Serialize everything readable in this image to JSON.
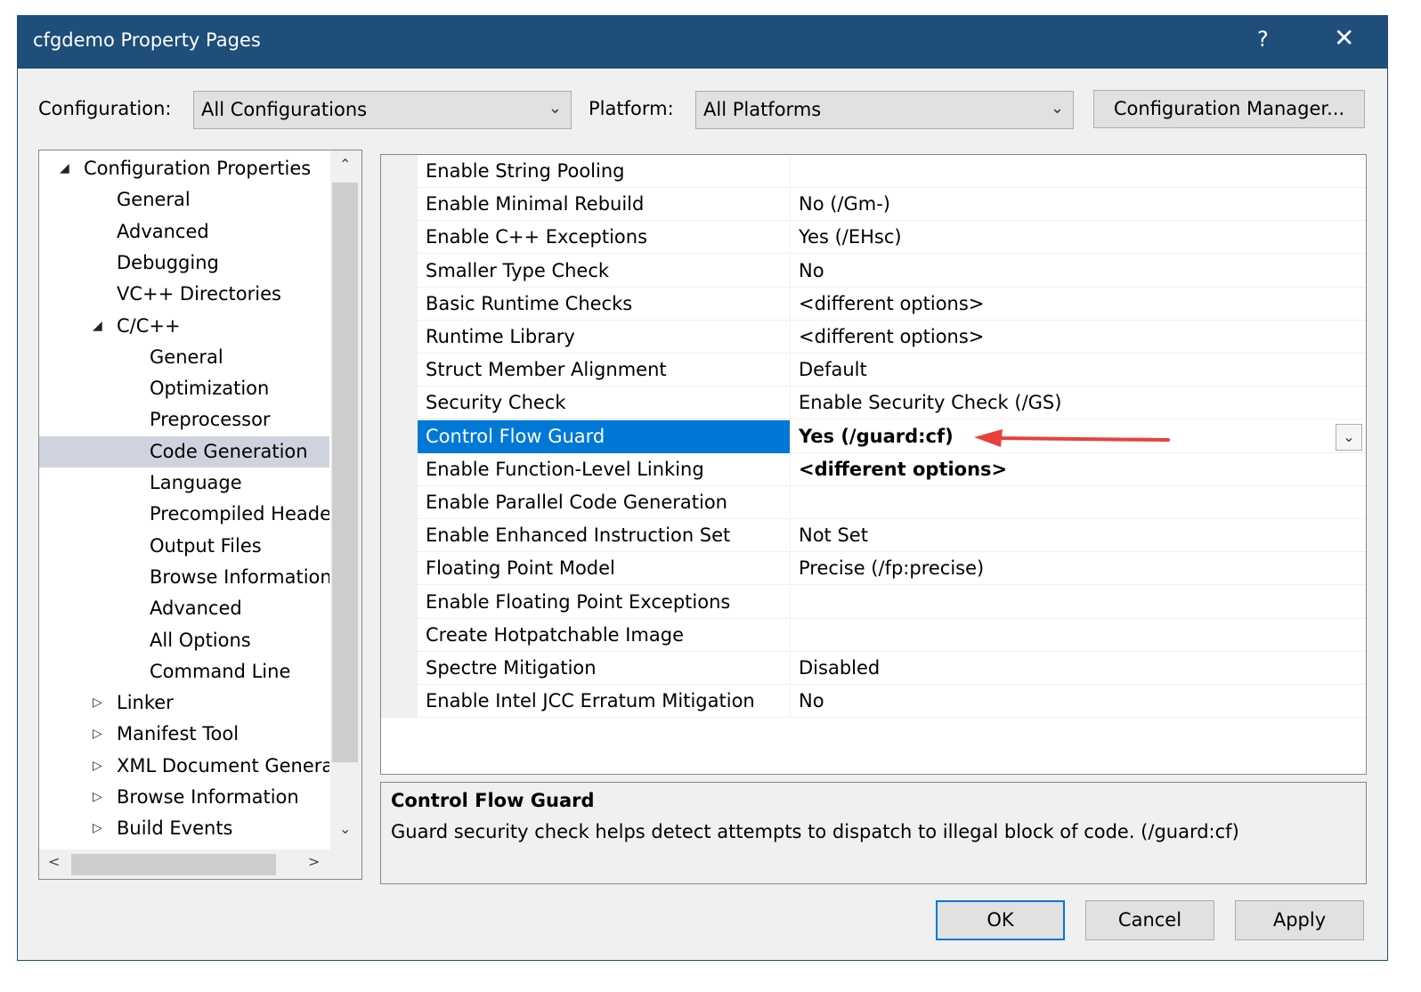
{
  "window": {
    "title": "cfgdemo Property Pages",
    "help": "?",
    "close": "✕"
  },
  "toolbar": {
    "configuration_label": "Configuration:",
    "configuration_value": "All Configurations",
    "platform_label": "Platform:",
    "platform_value": "All Platforms",
    "config_manager": "Configuration Manager..."
  },
  "tree": [
    {
      "label": "Configuration Properties",
      "level": 0,
      "expander": "expanded"
    },
    {
      "label": "General",
      "level": 1,
      "expander": "none"
    },
    {
      "label": "Advanced",
      "level": 1,
      "expander": "none"
    },
    {
      "label": "Debugging",
      "level": 1,
      "expander": "none"
    },
    {
      "label": "VC++ Directories",
      "level": 1,
      "expander": "none"
    },
    {
      "label": "C/C++",
      "level": 1,
      "expander": "expanded"
    },
    {
      "label": "General",
      "level": 2,
      "expander": "none"
    },
    {
      "label": "Optimization",
      "level": 2,
      "expander": "none"
    },
    {
      "label": "Preprocessor",
      "level": 2,
      "expander": "none"
    },
    {
      "label": "Code Generation",
      "level": 2,
      "expander": "none",
      "selected": true
    },
    {
      "label": "Language",
      "level": 2,
      "expander": "none"
    },
    {
      "label": "Precompiled Heade",
      "level": 2,
      "expander": "none"
    },
    {
      "label": "Output Files",
      "level": 2,
      "expander": "none"
    },
    {
      "label": "Browse Information",
      "level": 2,
      "expander": "none"
    },
    {
      "label": "Advanced",
      "level": 2,
      "expander": "none"
    },
    {
      "label": "All Options",
      "level": 2,
      "expander": "none"
    },
    {
      "label": "Command Line",
      "level": 2,
      "expander": "none"
    },
    {
      "label": "Linker",
      "level": 1,
      "expander": "collapsed"
    },
    {
      "label": "Manifest Tool",
      "level": 1,
      "expander": "collapsed"
    },
    {
      "label": "XML Document Genera",
      "level": 1,
      "expander": "collapsed"
    },
    {
      "label": "Browse Information",
      "level": 1,
      "expander": "collapsed"
    },
    {
      "label": "Build Events",
      "level": 1,
      "expander": "collapsed"
    }
  ],
  "properties": [
    {
      "name": "Enable String Pooling",
      "value": ""
    },
    {
      "name": "Enable Minimal Rebuild",
      "value": "No (/Gm-)"
    },
    {
      "name": "Enable C++ Exceptions",
      "value": "Yes (/EHsc)"
    },
    {
      "name": "Smaller Type Check",
      "value": "No"
    },
    {
      "name": "Basic Runtime Checks",
      "value": "<different options>"
    },
    {
      "name": "Runtime Library",
      "value": "<different options>"
    },
    {
      "name": "Struct Member Alignment",
      "value": "Default"
    },
    {
      "name": "Security Check",
      "value": "Enable Security Check (/GS)"
    },
    {
      "name": "Control Flow Guard",
      "value": "Yes (/guard:cf)",
      "bold": true,
      "selected": true
    },
    {
      "name": "Enable Function-Level Linking",
      "value": "<different options>",
      "bold": true
    },
    {
      "name": "Enable Parallel Code Generation",
      "value": ""
    },
    {
      "name": "Enable Enhanced Instruction Set",
      "value": "Not Set"
    },
    {
      "name": "Floating Point Model",
      "value": "Precise (/fp:precise)"
    },
    {
      "name": "Enable Floating Point Exceptions",
      "value": ""
    },
    {
      "name": "Create Hotpatchable Image",
      "value": ""
    },
    {
      "name": "Spectre Mitigation",
      "value": "Disabled"
    },
    {
      "name": "Enable Intel JCC Erratum Mitigation",
      "value": "No"
    }
  ],
  "description": {
    "title": "Control Flow Guard",
    "text": "Guard security check helps detect attempts to dispatch to illegal block of code. (/guard:cf)"
  },
  "buttons": {
    "ok": "OK",
    "cancel": "Cancel",
    "apply": "Apply"
  },
  "annotation": {
    "arrow_color": "#e8413c"
  },
  "colors": {
    "titlebar": "#1e4e79",
    "selection": "#0078d7",
    "tree_selection": "#cfd3de"
  }
}
